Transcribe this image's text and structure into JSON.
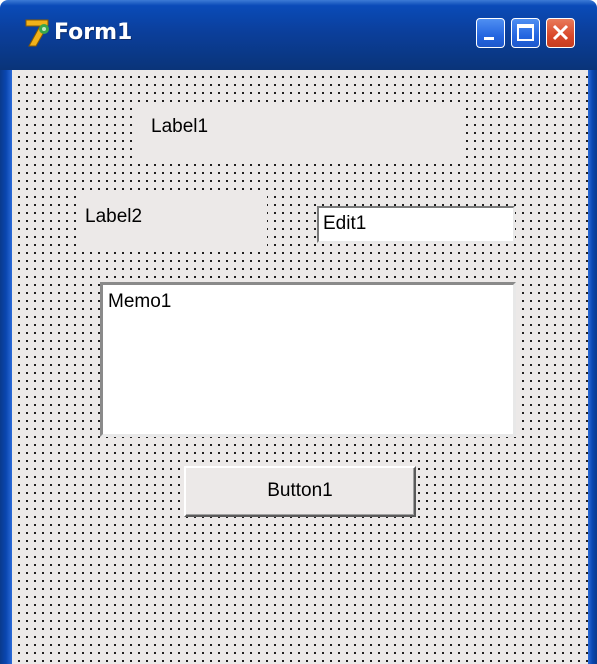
{
  "window": {
    "title": "Form1",
    "icon": "delphi-app-icon",
    "buttons": {
      "minimize": "minimize-icon",
      "maximize": "maximize-icon",
      "close": "close-icon"
    }
  },
  "form": {
    "label1": "Label1",
    "label2": "Label2",
    "edit1": "Edit1",
    "memo1": "Memo1",
    "button1": "Button1"
  },
  "colors": {
    "titlebar": "#0b3f9c",
    "client_background": "#ece9e8",
    "close_button": "#d9482a"
  }
}
